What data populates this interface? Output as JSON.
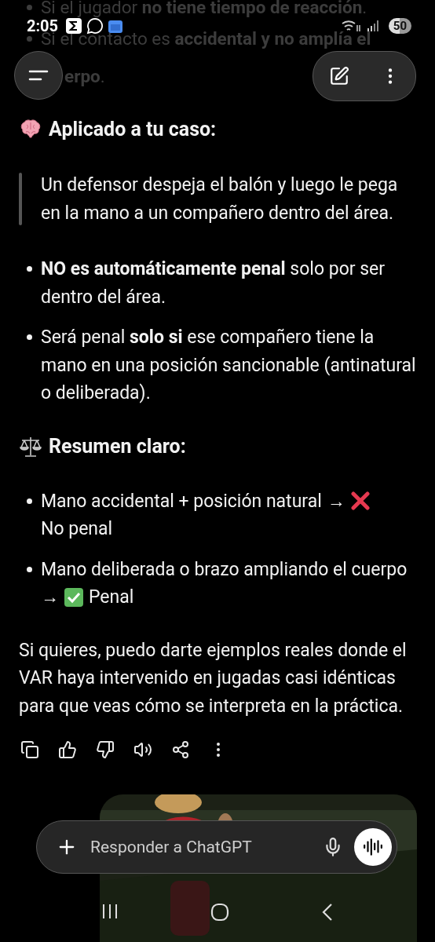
{
  "status_bar": {
    "time": "2:05",
    "battery": "50"
  },
  "faded_bullets": [
    {
      "text": "Si el jugador **no tiene tiempo de reacción**."
    },
    {
      "text": "Si el contacto es **accidental y no amplía el**",
      "continuation": "**erpo**."
    }
  ],
  "sections": [
    {
      "kind": "brain",
      "heading": "Aplicado a tu caso:",
      "quote": "Un defensor despeja el balón y luego le pega en la mano a un compañero dentro del área.",
      "bullets": [
        {
          "text": "**NO es automáticamente penal** solo por ser dentro del área."
        },
        {
          "text": "Será penal **solo si** ese compañero tiene la mano en una posición sancionable (antinatural o deliberada)."
        }
      ]
    },
    {
      "kind": "scales",
      "heading": "Resumen claro:",
      "bullets": [
        {
          "kind": "cross",
          "text": "Mano accidental + posición natural",
          "arrow": "→",
          "after": "No penal"
        },
        {
          "kind": "check",
          "text": "Mano deliberada o brazo ampliando el cuerpo",
          "arrow": "→",
          "after": "Penal"
        }
      ]
    }
  ],
  "closing": "Si quieres, puedo darte ejemplos reales donde el VAR haya intervenido en jugadas casi idénticas para que veas cómo se interpreta en la práctica.",
  "composer": {
    "placeholder": "Responder a ChatGPT"
  }
}
